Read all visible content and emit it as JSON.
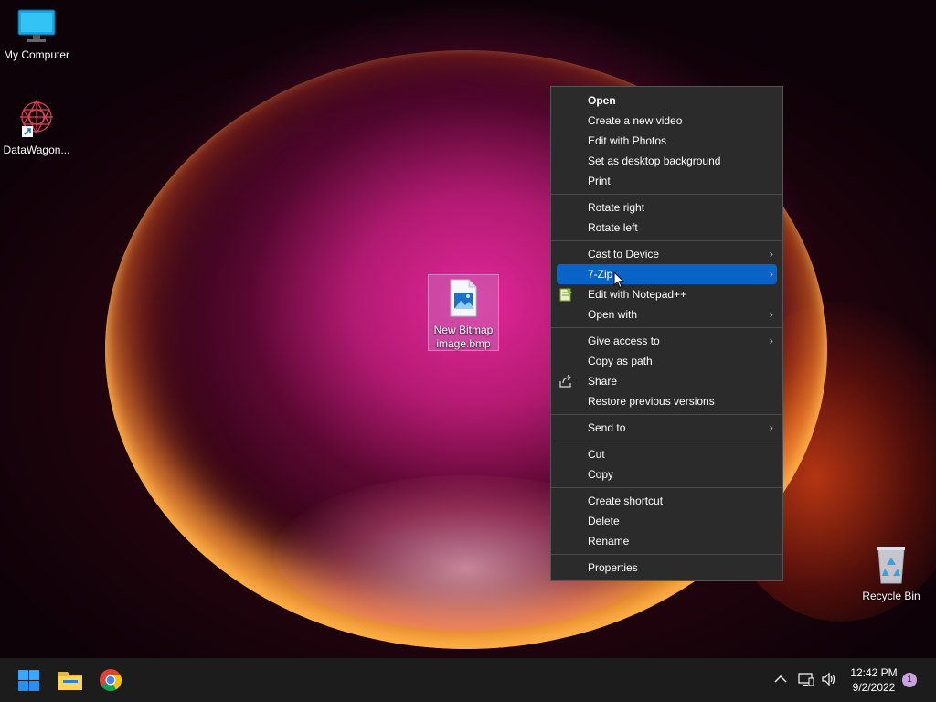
{
  "desktop": {
    "icons": [
      {
        "label": "My Computer",
        "icon": "monitor-icon"
      },
      {
        "label": "DataWagon...",
        "icon": "datawagon-shortcut-icon"
      },
      {
        "label": "New Bitmap image.bmp",
        "icon": "bitmap-file-icon"
      },
      {
        "label": "Recycle Bin",
        "icon": "recycle-bin-icon"
      }
    ]
  },
  "context_menu": {
    "items": [
      {
        "label": "Open",
        "bold": true
      },
      {
        "label": "Create a new video"
      },
      {
        "label": "Edit with Photos"
      },
      {
        "label": "Set as desktop background"
      },
      {
        "label": "Print"
      },
      {
        "label": "Rotate right"
      },
      {
        "label": "Rotate left"
      },
      {
        "label": "Cast to Device",
        "submenu": true
      },
      {
        "label": "7-Zip",
        "submenu": true,
        "highlighted": true
      },
      {
        "label": "Edit with Notepad++",
        "icon": "notepadpp-icon"
      },
      {
        "label": "Open with",
        "submenu": true
      },
      {
        "label": "Give access to",
        "submenu": true
      },
      {
        "label": "Copy as path"
      },
      {
        "label": "Share",
        "icon": "share-icon"
      },
      {
        "label": "Restore previous versions"
      },
      {
        "label": "Send to",
        "submenu": true
      },
      {
        "label": "Cut"
      },
      {
        "label": "Copy"
      },
      {
        "label": "Create shortcut"
      },
      {
        "label": "Delete"
      },
      {
        "label": "Rename"
      },
      {
        "label": "Properties"
      }
    ],
    "submenu_arrow": "›"
  },
  "taskbar": {
    "apps": [
      "windows-start-icon",
      "file-explorer-icon",
      "chrome-icon"
    ],
    "tray_icons": [
      "chevron-up-icon",
      "network-icon",
      "volume-icon"
    ],
    "time": "12:42 PM",
    "date": "9/2/2022",
    "notification_count": "1"
  },
  "colors": {
    "menu_bg": "#2b2b2b",
    "highlight": "#0a64c8",
    "taskbar_bg": "#1c1c1c"
  }
}
